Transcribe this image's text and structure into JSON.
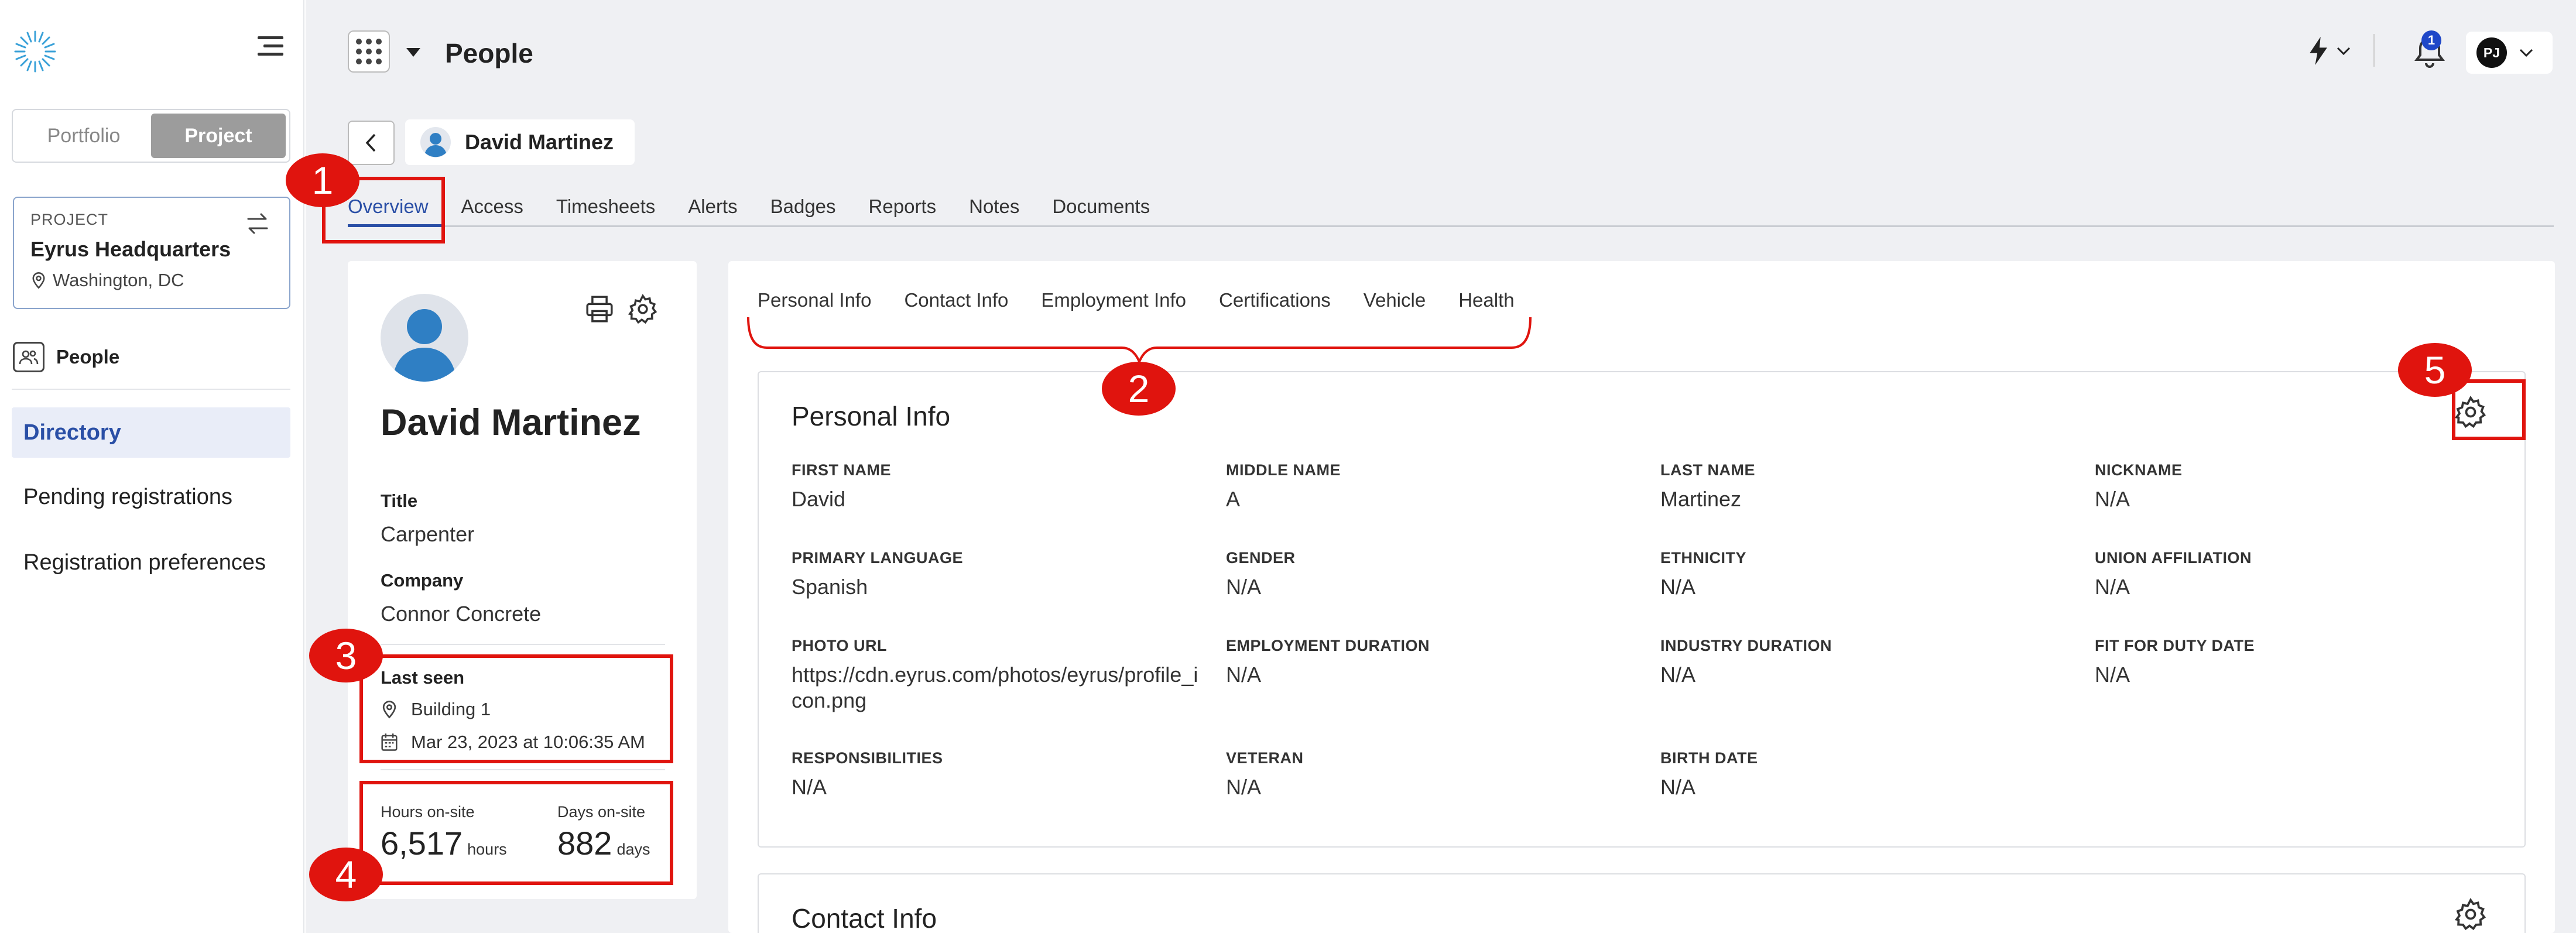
{
  "sidebar": {
    "toggle": {
      "portfolio": "Portfolio",
      "project": "Project"
    },
    "project_card": {
      "label": "PROJECT",
      "name": "Eyrus Headquarters",
      "location": "Washington, DC"
    },
    "section": "People",
    "nav": [
      {
        "label": "Directory",
        "active": true
      },
      {
        "label": "Pending registrations",
        "active": false
      },
      {
        "label": "Registration preferences",
        "active": false
      }
    ]
  },
  "header": {
    "title": "People",
    "notifications_count": "1",
    "user_initials": "PJ"
  },
  "person": {
    "name": "David Martinez"
  },
  "tabs": [
    "Overview",
    "Access",
    "Timesheets",
    "Alerts",
    "Badges",
    "Reports",
    "Notes",
    "Documents"
  ],
  "profile": {
    "name": "David Martinez",
    "title_label": "Title",
    "title": "Carpenter",
    "company_label": "Company",
    "company": "Connor Concrete",
    "last_seen_label": "Last seen",
    "last_seen_location": "Building 1",
    "last_seen_time": "Mar 23, 2023 at 10:06:35 AM",
    "hours_label": "Hours on-site",
    "hours_value": "6,517",
    "hours_unit": "hours",
    "days_label": "Days on-site",
    "days_value": "882",
    "days_unit": "days"
  },
  "subtabs": [
    "Personal Info",
    "Contact Info",
    "Employment Info",
    "Certifications",
    "Vehicle",
    "Health"
  ],
  "personal_info": {
    "title": "Personal Info",
    "fields": [
      {
        "label": "FIRST NAME",
        "value": "David"
      },
      {
        "label": "MIDDLE NAME",
        "value": "A"
      },
      {
        "label": "LAST NAME",
        "value": "Martinez"
      },
      {
        "label": "NICKNAME",
        "value": "N/A"
      },
      {
        "label": "PRIMARY LANGUAGE",
        "value": "Spanish"
      },
      {
        "label": "GENDER",
        "value": "N/A"
      },
      {
        "label": "ETHNICITY",
        "value": "N/A"
      },
      {
        "label": "UNION AFFILIATION",
        "value": "N/A"
      },
      {
        "label": "PHOTO URL",
        "value": "https://cdn.eyrus.com/photos/eyrus/profile_icon.png"
      },
      {
        "label": "EMPLOYMENT DURATION",
        "value": "N/A"
      },
      {
        "label": "INDUSTRY DURATION",
        "value": "N/A"
      },
      {
        "label": "FIT FOR DUTY DATE",
        "value": "N/A"
      },
      {
        "label": "RESPONSIBILITIES",
        "value": "N/A"
      },
      {
        "label": "VETERAN",
        "value": "N/A"
      },
      {
        "label": "BIRTH DATE",
        "value": "N/A"
      }
    ]
  },
  "contact_info": {
    "title": "Contact Info"
  },
  "annotations": [
    "1",
    "2",
    "3",
    "4",
    "5"
  ],
  "colors": {
    "accent": "#2a4fa6",
    "annotation": "#e0140e",
    "badge": "#1f47c8"
  }
}
